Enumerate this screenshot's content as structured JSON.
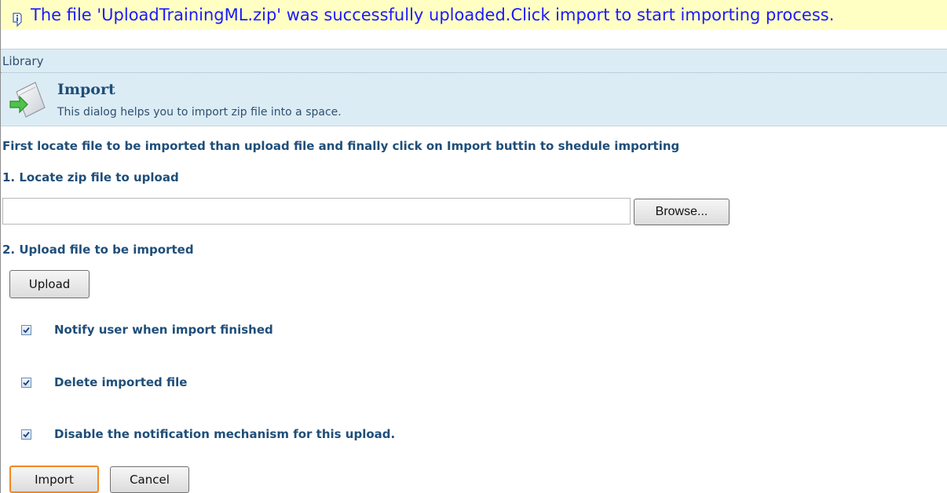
{
  "message": {
    "text": "The file 'UploadTrainingML.zip' was successfully uploaded.Click import to start importing process.",
    "icon": "info-icon"
  },
  "header": {
    "breadcrumb": "Library",
    "title": "Import",
    "description": "This dialog helps you to import zip file into a space.",
    "icon": "import-document-icon"
  },
  "instructions": "First locate file to be imported than upload file and finally click on Import buttin to shedule importing",
  "step1": {
    "label": "1. Locate zip file to upload",
    "file_value": "",
    "browse_label": "Browse..."
  },
  "step2": {
    "label": "2. Upload file to be imported",
    "upload_label": "Upload"
  },
  "options": [
    {
      "label": "Notify user when import finished",
      "checked": true
    },
    {
      "label": "Delete imported file",
      "checked": true
    },
    {
      "label": "Disable the notification mechanism for this upload.",
      "checked": true
    }
  ],
  "actions": {
    "import_label": "Import",
    "cancel_label": "Cancel"
  },
  "colors": {
    "message_bg": "#ffffc4",
    "message_text": "#1a1aff",
    "header_bg": "#dcecf5",
    "label_text": "#1f4e79",
    "focus_border": "#f08a24"
  }
}
